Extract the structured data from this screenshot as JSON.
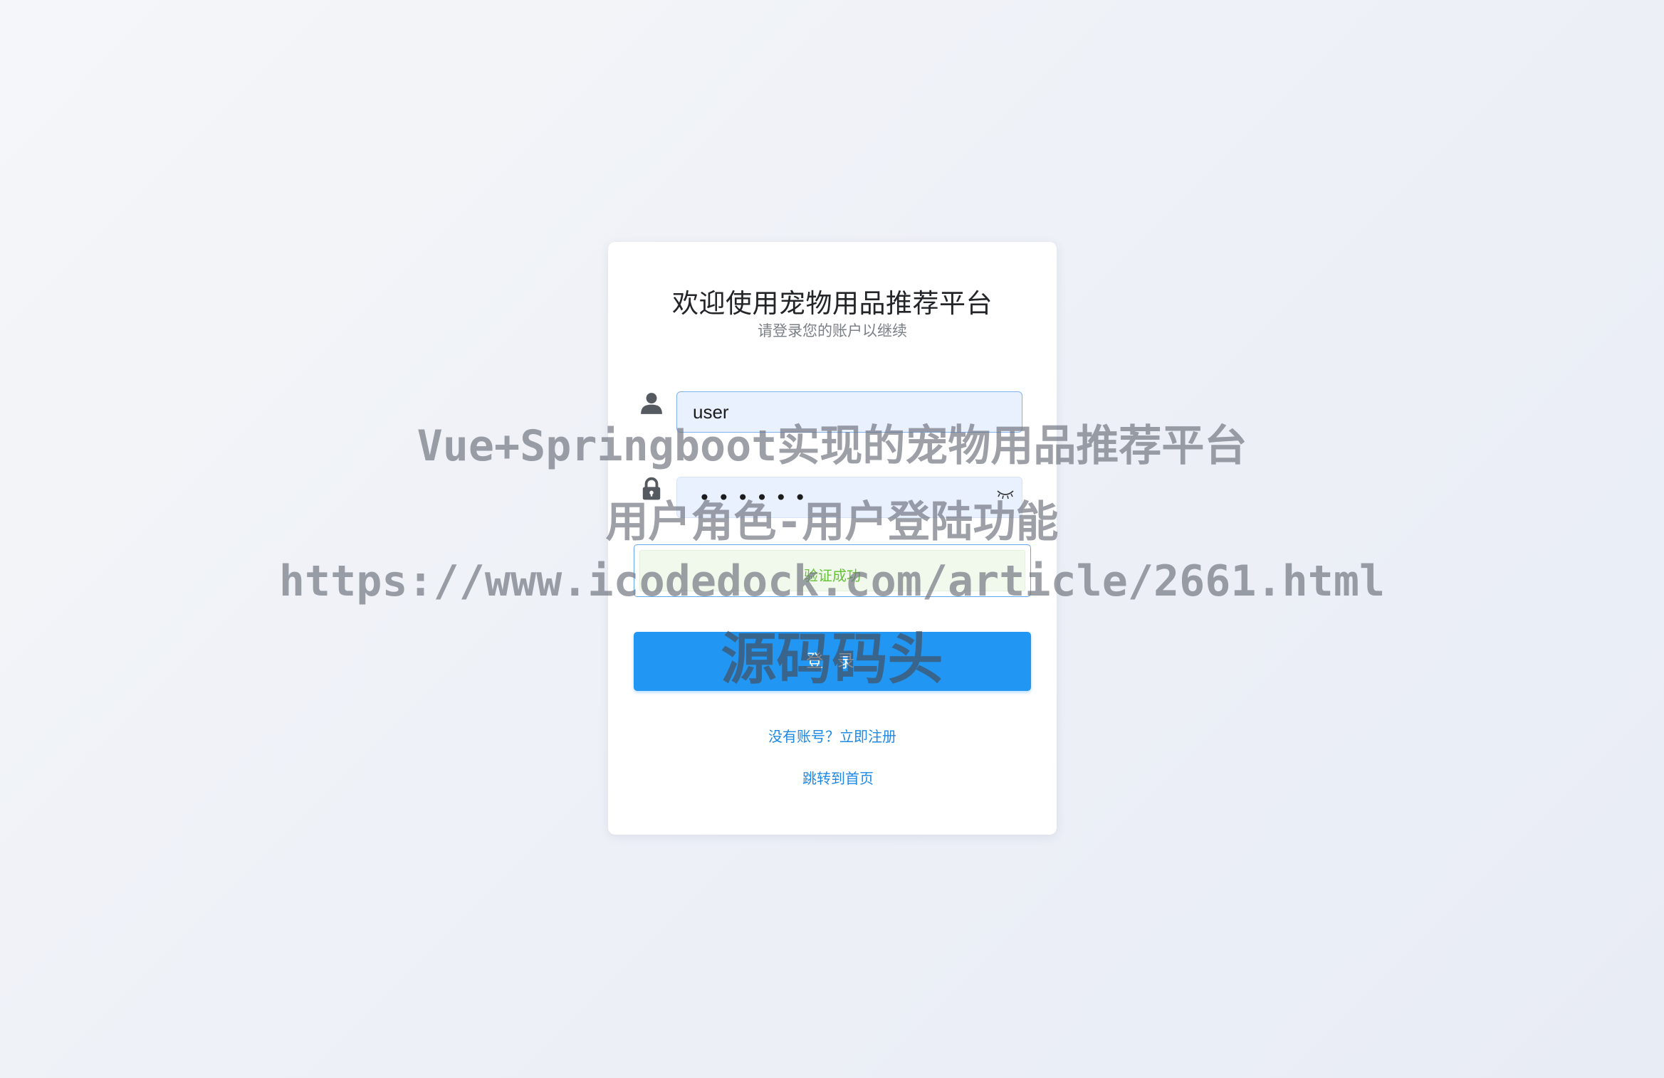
{
  "login": {
    "title": "欢迎使用宠物用品推荐平台",
    "subtitle": "请登录您的账户以继续",
    "username_value": "user",
    "password_mask": "••••••",
    "verify_text": "验证成功",
    "login_button": "登 录",
    "register_link": "没有账号？立即注册",
    "home_link": "跳转到首页"
  },
  "icons": {
    "username": "user-icon",
    "password": "lock-icon",
    "toggle_password": "eye-closed-icon"
  },
  "colors": {
    "primary": "#2196f3",
    "link": "#1e88e5",
    "success": "#67c23a",
    "input_bg": "#e9f0fe"
  },
  "watermark": {
    "line1": "Vue+Springboot实现的宠物用品推荐平台",
    "line2": "用户角色-用户登陆功能",
    "line3": "https://www.icodedock.com/article/2661.html",
    "line4": "源码码头"
  }
}
